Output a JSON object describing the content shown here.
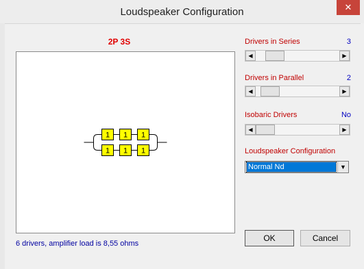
{
  "window": {
    "title": "Loudspeaker Configuration",
    "close_glyph": "✕"
  },
  "diagram": {
    "title": "2P 3S",
    "series_count": 3,
    "parallel_count": 2,
    "driver_label": "1",
    "driver_color": "#ffff00"
  },
  "status": {
    "text": "6 drivers, amplifier load is 8,55 ohms"
  },
  "controls": {
    "series": {
      "label": "Drivers in Series",
      "value": "3",
      "position": 0.15
    },
    "parallel": {
      "label": "Drivers in Parallel",
      "value": "2",
      "position": 0.07
    },
    "isobaric": {
      "label": "Isobaric Drivers",
      "value": "No",
      "position": 0.0
    },
    "configuration": {
      "label": "Loudspeaker Configuration",
      "selected": "Normal Nd"
    }
  },
  "buttons": {
    "ok": "OK",
    "cancel": "Cancel"
  },
  "colors": {
    "label_red": "#c00000",
    "value_blue": "#0000c0",
    "status_blue": "#0000a0",
    "selection": "#0078d7"
  }
}
